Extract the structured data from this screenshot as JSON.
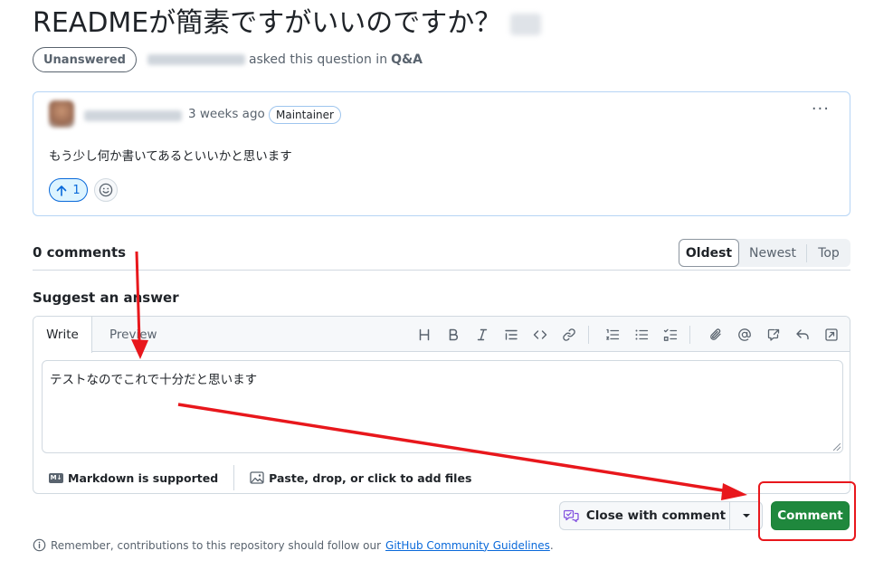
{
  "header": {
    "title": "READMEが簡素ですがいいのですか？",
    "state_badge": "Unanswered",
    "asked_text": "asked this question in",
    "category": "Q&A"
  },
  "post": {
    "time": "3 weeks ago",
    "role_badge": "Maintainer",
    "body": "もう少し何か書いてあるといいかと思います",
    "upvote_count": "1",
    "more_glyph": "···"
  },
  "comments": {
    "count_label": "0 comments",
    "sort": [
      "Oldest",
      "Newest",
      "Top"
    ]
  },
  "editor": {
    "heading": "Suggest an answer",
    "tabs": {
      "write": "Write",
      "preview": "Preview"
    },
    "text": "テストなのでこれで十分だと思います",
    "markdown_hint": "Markdown is supported",
    "attach_hint": "Paste, drop, or click to add files"
  },
  "actions": {
    "close_label": "Close with comment",
    "comment_label": "Comment"
  },
  "footer": {
    "guideline_prefix": "Remember, contributions to this repository should follow our",
    "guideline_link": "GitHub Community Guidelines",
    "guideline_suffix": "."
  },
  "colors": {
    "annotation": "#e8171c",
    "primary_green": "#1f883d",
    "accent_blue": "#0969da"
  }
}
